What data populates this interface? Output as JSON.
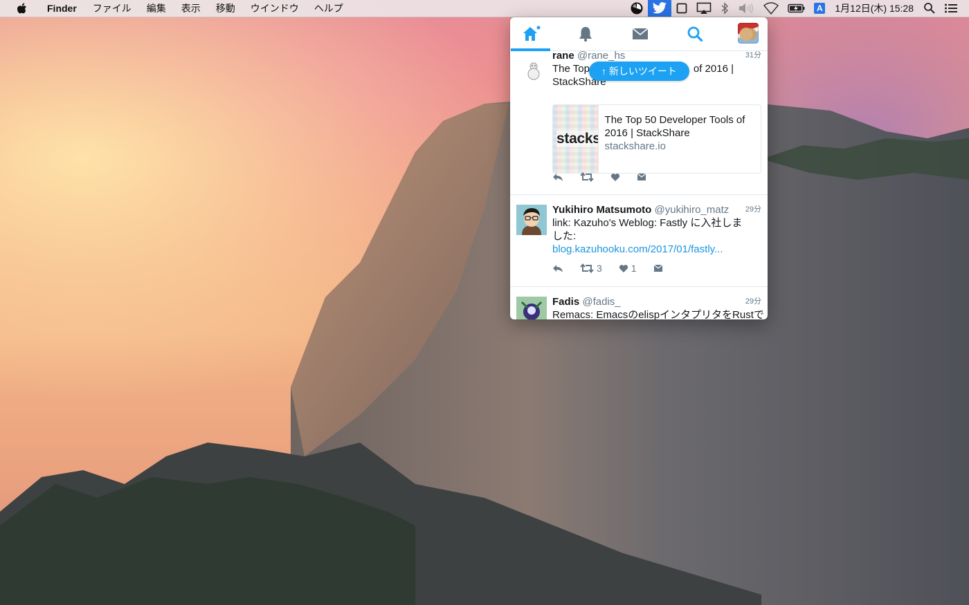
{
  "menubar": {
    "app_name": "Finder",
    "menus": [
      "ファイル",
      "編集",
      "表示",
      "移動",
      "ウインドウ",
      "ヘルプ"
    ],
    "ime_label": "A",
    "clock": "1月12日(木) 15:28"
  },
  "popover": {
    "tabs": [
      {
        "icon": "home-icon",
        "active": true
      },
      {
        "icon": "bell-icon",
        "active": false
      },
      {
        "icon": "envelope-icon",
        "active": false
      },
      {
        "icon": "search-icon",
        "active": false
      }
    ],
    "new_tweets_label": "↑ 新しいツイート",
    "tweets": [
      {
        "name": "rane",
        "handle": "@rane_hs",
        "time": "31分",
        "text_line1": "The Top",
        "text_line1_end": "of 2016 |",
        "text_line2": "StackShare",
        "card": {
          "thumb_text": "stacksha",
          "title": "The Top 50 Developer Tools of 2016 | StackShare",
          "domain": "stackshare.io"
        }
      },
      {
        "name": "Yukihiro Matsumoto",
        "handle": "@yukihiro_matz",
        "time": "29分",
        "text": "link: Kazuho's Weblog: Fastly に入社しました:",
        "link": "blog.kazuhooku.com/2017/01/fastly...",
        "retweets": "3",
        "likes": "1"
      },
      {
        "name": "Fadis",
        "handle": "@fadis_",
        "time": "29分",
        "text": "Remacs: EmacsのelispインタプリタをRustで"
      }
    ]
  },
  "colors": {
    "twitter_blue": "#1da1f2",
    "link_blue": "#1b95e0",
    "menubar_active": "#2a74e6"
  }
}
